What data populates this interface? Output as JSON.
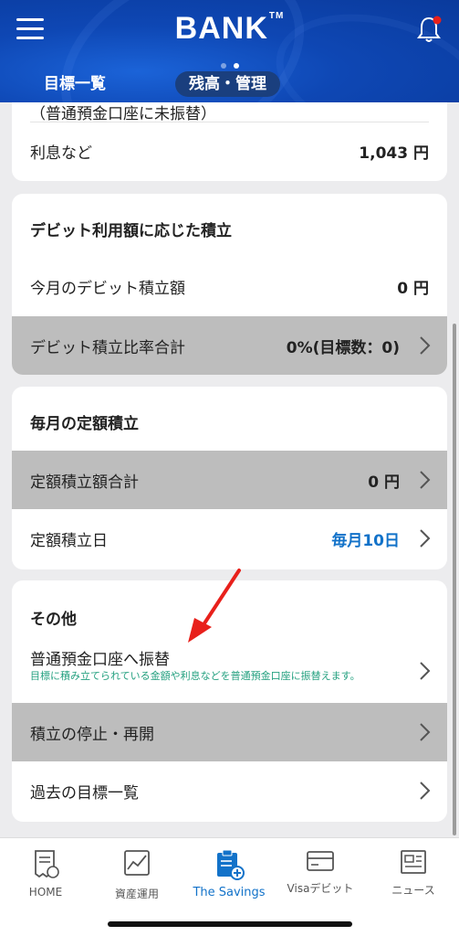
{
  "header": {
    "logo": "BANK",
    "logo_tm": "TM",
    "tab_left": "目標一覧",
    "tab_right": "残高・管理"
  },
  "interest_card": {
    "cut_text": "（普通預金口座に未振替）",
    "label": "利息など",
    "value": "1,043 円"
  },
  "debit_section": {
    "title": "デビット利用額に応じた積立",
    "monthly_label": "今月のデビット積立額",
    "monthly_value": "0 円",
    "ratio_label": "デビット積立比率合計",
    "ratio_value": "0%(目標数：0)"
  },
  "fixed_section": {
    "title": "毎月の定額積立",
    "total_label": "定額積立額合計",
    "total_value": "0 円",
    "day_label": "定額積立日",
    "day_value": "毎月10日"
  },
  "other_section": {
    "title": "その他",
    "transfer_label": "普通預金口座へ振替",
    "transfer_sub": "目標に積み立てられている金額や利息などを普通預金口座に振替えます。",
    "pause_label": "積立の停止・再開",
    "past_label": "過去の目標一覧"
  },
  "bottom_nav": {
    "home": "HOME",
    "assets": "資産運用",
    "savings": "The Savings",
    "visa": "Visaデビット",
    "news": "ニュース"
  },
  "colors": {
    "header_blue": "#0e47b4",
    "accent_blue": "#1272c9",
    "green_note": "#23a07f",
    "gray_row": "#bdbdbd",
    "arrow_red": "#e8201b"
  }
}
